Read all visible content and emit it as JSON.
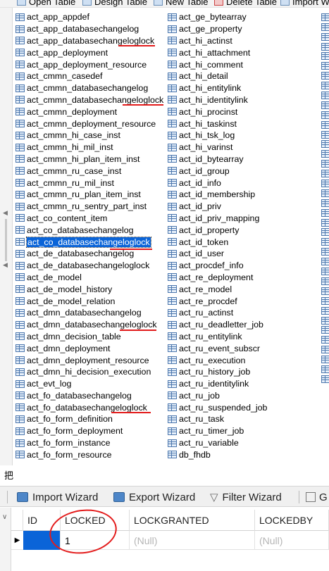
{
  "top_toolbar": {
    "items": [
      "Open Table",
      "Design Table",
      "New Table",
      "Delete Table",
      "Import W"
    ]
  },
  "table_list": {
    "column1": [
      "act_app_appdef",
      "act_app_databasechangelog",
      "act_app_databasechangeloglock",
      "act_app_deployment",
      "act_app_deployment_resource",
      "act_cmmn_casedef",
      "act_cmmn_databasechangelog",
      "act_cmmn_databasechangeloglock",
      "act_cmmn_deployment",
      "act_cmmn_deployment_resource",
      "act_cmmn_hi_case_inst",
      "act_cmmn_hi_mil_inst",
      "act_cmmn_hi_plan_item_inst",
      "act_cmmn_ru_case_inst",
      "act_cmmn_ru_mil_inst",
      "act_cmmn_ru_plan_item_inst",
      "act_cmmn_ru_sentry_part_inst",
      "act_co_content_item",
      "act_co_databasechangelog",
      "act_co_databasechangeloglock",
      "act_de_databasechangelog",
      "act_de_databasechangeloglock",
      "act_de_model",
      "act_de_model_history",
      "act_de_model_relation",
      "act_dmn_databasechangelog",
      "act_dmn_databasechangeloglock",
      "act_dmn_decision_table",
      "act_dmn_deployment",
      "act_dmn_deployment_resource",
      "act_dmn_hi_decision_execution",
      "act_evt_log",
      "act_fo_databasechangelog",
      "act_fo_databasechangeloglock",
      "act_fo_form_definition",
      "act_fo_form_deployment",
      "act_fo_form_instance",
      "act_fo_form_resource"
    ],
    "column2": [
      "act_ge_bytearray",
      "act_ge_property",
      "act_hi_actinst",
      "act_hi_attachment",
      "act_hi_comment",
      "act_hi_detail",
      "act_hi_entitylink",
      "act_hi_identitylink",
      "act_hi_procinst",
      "act_hi_taskinst",
      "act_hi_tsk_log",
      "act_hi_varinst",
      "act_id_bytearray",
      "act_id_group",
      "act_id_info",
      "act_id_membership",
      "act_id_priv",
      "act_id_priv_mapping",
      "act_id_property",
      "act_id_token",
      "act_id_user",
      "act_procdef_info",
      "act_re_deployment",
      "act_re_model",
      "act_re_procdef",
      "act_ru_actinst",
      "act_ru_deadletter_job",
      "act_ru_entitylink",
      "act_ru_event_subscr",
      "act_ru_execution",
      "act_ru_history_job",
      "act_ru_identitylink",
      "act_ru_job",
      "act_ru_suspended_job",
      "act_ru_task",
      "act_ru_timer_job",
      "act_ru_variable",
      "db_fhdb"
    ],
    "selected": "act_co_databasechangeloglock",
    "annotation_color": "#e21b1b"
  },
  "note": "把",
  "bottom_toolbar": {
    "import_wizard": "Import Wizard",
    "export_wizard": "Export Wizard",
    "filter_wizard": "Filter Wizard",
    "cut_off": "G"
  },
  "grid": {
    "columns": [
      "ID",
      "LOCKED",
      "LOCKGRANTED",
      "LOCKEDBY"
    ],
    "row": {
      "id": "",
      "locked": "1",
      "lockgranted": "(Null)",
      "lockedby": "(Null)"
    },
    "selection_color": "#0a64d8"
  }
}
